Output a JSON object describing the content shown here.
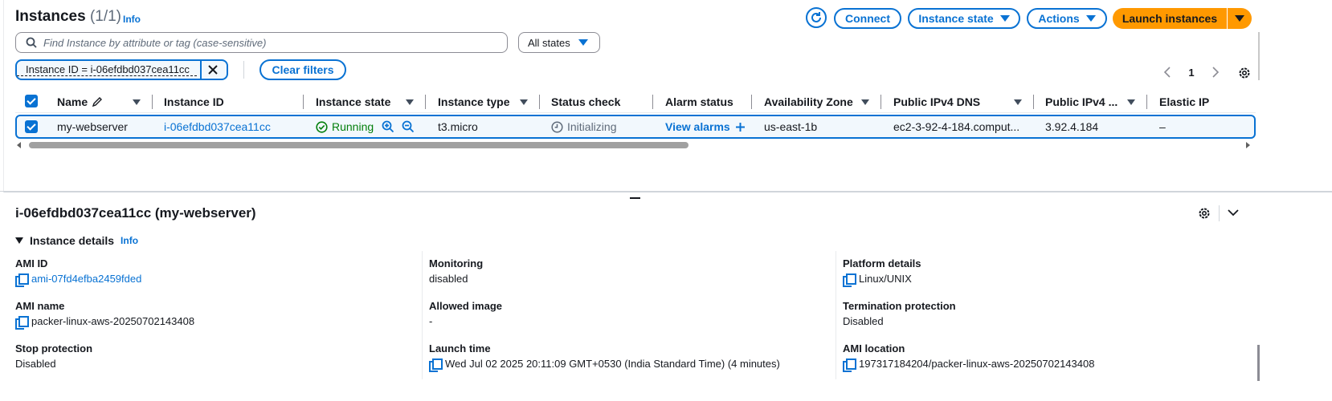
{
  "header": {
    "title": "Instances",
    "count": "(1/1)",
    "info": "Info"
  },
  "toolbar": {
    "connect": "Connect",
    "instance_state": "Instance state",
    "actions": "Actions",
    "launch": "Launch instances"
  },
  "search": {
    "placeholder": "Find Instance by attribute or tag (case-sensitive)",
    "states_filter": "All states"
  },
  "filters": {
    "token": "Instance ID = i-06efdbd037cea11cc",
    "clear": "Clear filters"
  },
  "pagination": {
    "page": "1"
  },
  "table": {
    "columns": [
      "Name",
      "Instance ID",
      "Instance state",
      "Instance type",
      "Status check",
      "Alarm status",
      "Availability Zone",
      "Public IPv4 DNS",
      "Public IPv4 ...",
      "Elastic IP"
    ],
    "row": {
      "name": "my-webserver",
      "instance_id": "i-06efdbd037cea11cc",
      "state": "Running",
      "type": "t3.micro",
      "status_check": "Initializing",
      "alarm": "View alarms",
      "az": "us-east-1b",
      "dns": "ec2-3-92-4-184.comput...",
      "ipv4": "3.92.4.184",
      "elastic_ip": "–"
    }
  },
  "details": {
    "title": "i-06efdbd037cea11cc (my-webserver)",
    "section": "Instance details",
    "info": "Info",
    "ami_id_label": "AMI ID",
    "ami_id": "ami-07fd4efba2459fded",
    "monitoring_label": "Monitoring",
    "monitoring": "disabled",
    "platform_label": "Platform details",
    "platform": "Linux/UNIX",
    "ami_name_label": "AMI name",
    "ami_name": "packer-linux-aws-20250702143408",
    "allowed_image_label": "Allowed image",
    "allowed_image": "-",
    "termination_label": "Termination protection",
    "termination": "Disabled",
    "stop_label": "Stop protection",
    "stop": "Disabled",
    "launch_time_label": "Launch time",
    "launch_time": "Wed Jul 02 2025 20:11:09 GMT+0530 (India Standard Time) (4 minutes)",
    "ami_location_label": "AMI location",
    "ami_location": "197317184204/packer-linux-aws-20250702143408"
  },
  "colors": {
    "accent": "#0972d3",
    "launch_bg": "#ff9900",
    "running": "#037f0c",
    "row_selected": "#f2f8fd"
  }
}
